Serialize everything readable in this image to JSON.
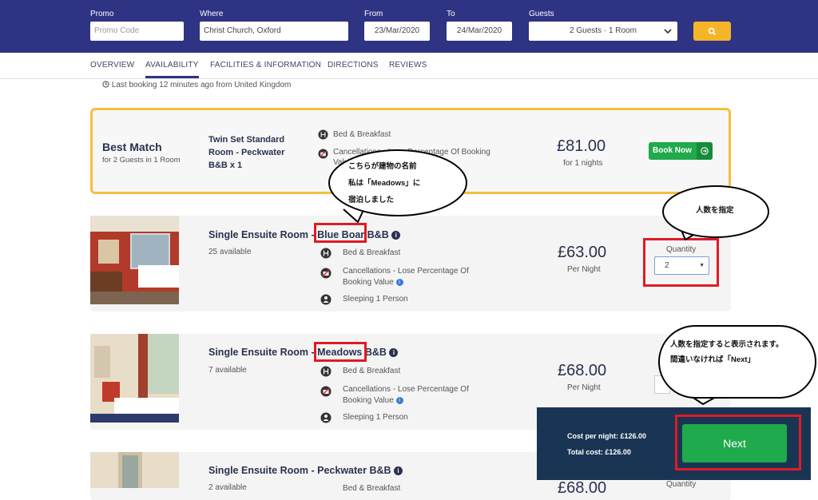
{
  "search": {
    "promo_label": "Promo",
    "promo_placeholder": "Promo Code",
    "where_label": "Where",
    "where_value": "Christ Church, Oxford",
    "from_label": "From",
    "from_value": "23/Mar/2020",
    "to_label": "To",
    "to_value": "24/Mar/2020",
    "guests_label": "Guests",
    "guests_value": "2 Guests · 1 Room"
  },
  "tabs": [
    "OVERVIEW",
    "AVAILABILITY",
    "FACILITIES & INFORMATION",
    "DIRECTIONS",
    "REVIEWS"
  ],
  "active_tab": "AVAILABILITY",
  "last_booking": "Last booking 12 minutes ago from United Kingdom",
  "best_match": {
    "title": "Best Match",
    "subtitle": "for 2 Guests in 1 Room",
    "room_name": "Twin Set Standard Room - Peckwater B&B x 1",
    "feature_1": "Bed & Breakfast",
    "feature_2": "Cancellations - Lose Percentage Of Booking Value",
    "price": "£81.00",
    "price_sub": "for 1 nights",
    "book_label": "Book Now"
  },
  "rooms": [
    {
      "title_prefix": "Single Ensuite Room - ",
      "title_name": "Blue Boar",
      "title_suffix": " B&B",
      "available": "25 available",
      "feature_1": "Bed & Breakfast",
      "feature_2a": "Cancellations - Lose Percentage Of",
      "feature_2b": "Booking Value",
      "feature_3": "Sleeping 1 Person",
      "price": "£63.00",
      "price_sub": "Per Night",
      "quantity_label": "Quantity",
      "quantity_value": "2"
    },
    {
      "title_prefix": "Single Ensuite Room - ",
      "title_name": "Meadows",
      "title_suffix": " B&B",
      "available": "7 available",
      "feature_1": "Bed & Breakfast",
      "feature_2a": "Cancellations - Lose Percentage Of",
      "feature_2b": "Booking Value",
      "feature_3": "Sleeping 1 Person",
      "price": "£68.00",
      "price_sub": "Per Night"
    },
    {
      "title": "Single Ensuite Room - Peckwater B&B",
      "available": "2 available",
      "feature_1": "Bed & Breakfast",
      "price": "£68.00",
      "quantity_label": "Quantity"
    }
  ],
  "cost_panel": {
    "cost_per_night": "Cost per night: £126.00",
    "total_cost": "Total cost: £126.00",
    "next_label": "Next"
  },
  "annotations": {
    "bubble_building_line1": "こちらが建物の名前",
    "bubble_building_line2": "私は「Meadows」に",
    "bubble_building_line3": "宿泊しました",
    "bubble_quantity": "人数を指定",
    "bubble_next_line1": "人数を指定すると表示されます。",
    "bubble_next_line2": "間違いなければ「Next」"
  },
  "colors": {
    "header_bg": "#2e3383",
    "search_button": "#f5b52a",
    "book_button": "#1faa4b",
    "best_match_border": "#f5c040",
    "cost_panel_bg": "#1a3553",
    "annotation_red": "#e01b24"
  }
}
